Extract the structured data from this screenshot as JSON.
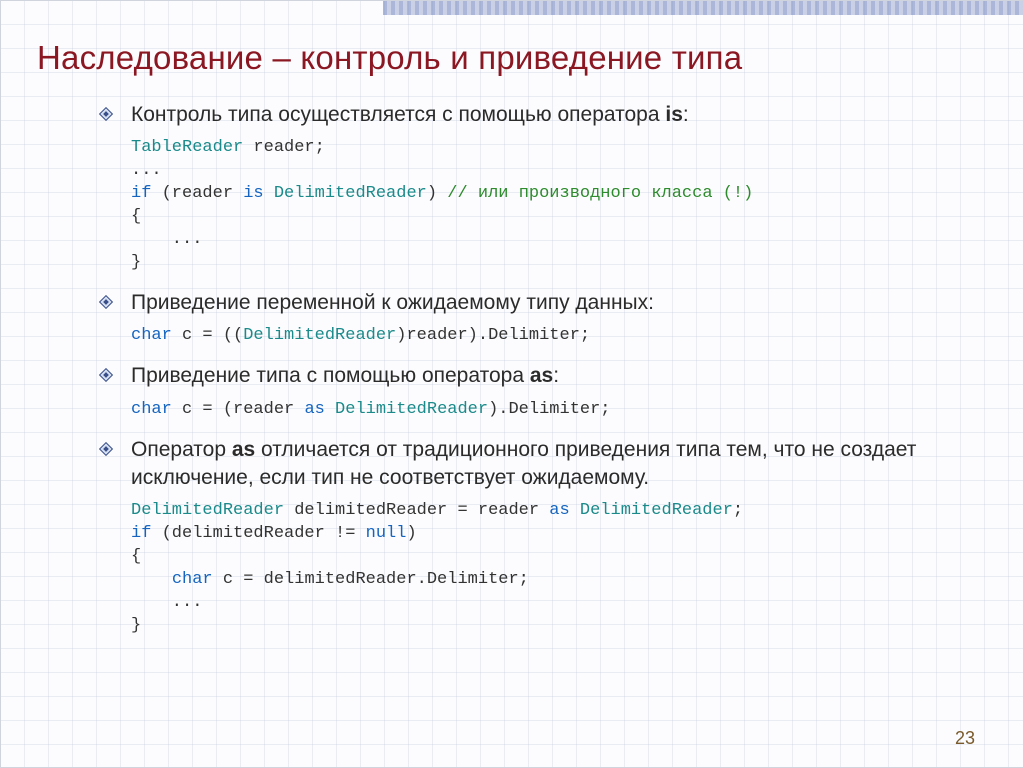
{
  "title": "Наследование – контроль и приведение типа",
  "bullets": {
    "b1_pre": "Контроль типа осуществляется с помощью оператора ",
    "b1_kw": "is",
    "b1_post": ":",
    "b2": "Приведение переменной к ожидаемому типу данных:",
    "b3_pre": "Приведение типа с помощью оператора ",
    "b3_kw": "as",
    "b3_post": ":",
    "b4_pre": "Оператор ",
    "b4_kw": "as",
    "b4_post": " отличается от традиционного приведения типа тем, что не создает исключение, если тип не соответствует ожидаемому."
  },
  "code": {
    "c1_l1_type": "TableReader",
    "c1_l1_rest": " reader;",
    "c1_l2": "...",
    "c1_l3_kw": "if",
    "c1_l3_mid": " (reader ",
    "c1_l3_is": "is",
    "c1_l3_sp": " ",
    "c1_l3_type": "DelimitedReader",
    "c1_l3_paren": ") ",
    "c1_l3_cm": "// или производного класса (!)",
    "c1_l4": "{",
    "c1_l5": "    ...",
    "c1_l6": "}",
    "c2_kw": "char",
    "c2_rest": " c = ((",
    "c2_type": "DelimitedReader",
    "c2_end": ")reader).Delimiter;",
    "c3_kw": "char",
    "c3_mid": " c = (reader ",
    "c3_as": "as",
    "c3_sp": " ",
    "c3_type": "DelimitedReader",
    "c3_end": ").Delimiter;",
    "c4_l1_type1": "DelimitedReader",
    "c4_l1_mid": " delimitedReader = reader ",
    "c4_l1_as": "as",
    "c4_l1_sp": " ",
    "c4_l1_type2": "DelimitedReader",
    "c4_l1_end": ";",
    "c4_l2_kw": "if",
    "c4_l2_mid": " (delimitedReader != ",
    "c4_l2_null": "null",
    "c4_l2_end": ")",
    "c4_l3": "{",
    "c4_l4_pre": "    ",
    "c4_l4_kw": "char",
    "c4_l4_rest": " c = delimitedReader.Delimiter;",
    "c4_l5": "    ...",
    "c4_l6": "}"
  },
  "slideNumber": "23"
}
